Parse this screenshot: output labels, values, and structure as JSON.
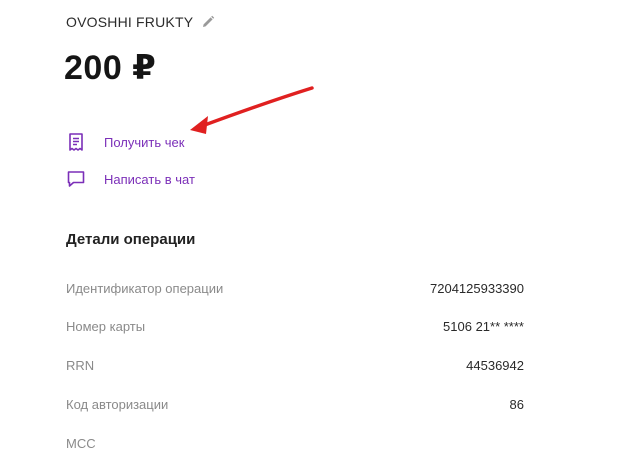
{
  "header": {
    "merchant_name": "OVOSHHI FRUKTY",
    "edit_icon": "pencil-icon",
    "amount": "200 ₽"
  },
  "actions": [
    {
      "label": "Получить чек",
      "icon": "receipt-icon"
    },
    {
      "label": "Написать в чат",
      "icon": "chat-icon"
    }
  ],
  "annotation": {
    "color": "#e02020"
  },
  "accent_color": "#7b2fb8",
  "details": {
    "title": "Детали операции",
    "rows": [
      {
        "key": "Идентификатор операции",
        "value": "7204125933390"
      },
      {
        "key": "Номер карты",
        "value": "5106 21** ****"
      },
      {
        "key": "RRN",
        "value": "44536942"
      },
      {
        "key": "Код авторизации",
        "value": "86"
      },
      {
        "key": "MCC",
        "value": ""
      }
    ]
  }
}
